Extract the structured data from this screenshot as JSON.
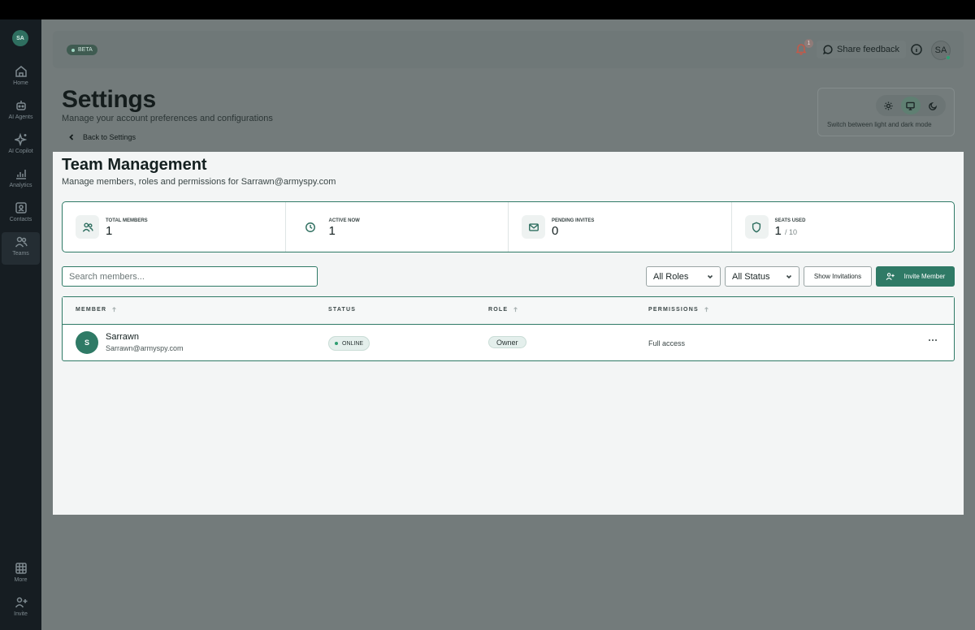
{
  "sidebar": {
    "avatar_initials": "SA",
    "items": [
      {
        "label": "Home",
        "icon": "home-icon"
      },
      {
        "label": "AI Agents",
        "icon": "robot-icon"
      },
      {
        "label": "AI Copilot",
        "icon": "sparkles-icon"
      },
      {
        "label": "Analytics",
        "icon": "bar-chart-icon"
      },
      {
        "label": "Contacts",
        "icon": "contact-card-icon"
      },
      {
        "label": "Teams",
        "icon": "users-icon",
        "active": true
      }
    ],
    "bottom_items": [
      {
        "label": "More",
        "icon": "grid-icon"
      },
      {
        "label": "Invite",
        "icon": "user-plus-icon"
      }
    ]
  },
  "topbar": {
    "beta_label": "BETA",
    "notification_count": "1",
    "feedback_label": "Share feedback",
    "user_initials": "SA"
  },
  "header": {
    "title": "Settings",
    "subtitle": "Manage your account preferences and configurations",
    "back_label": "Back to Settings"
  },
  "theme": {
    "caption": "Switch between light and dark mode",
    "options": [
      "light",
      "system",
      "dark"
    ],
    "selected": "system"
  },
  "team": {
    "title": "Team Management",
    "subtitle": "Manage members, roles and permissions for Sarrawn@armyspy.com"
  },
  "stats": [
    {
      "label": "TOTAL MEMBERS",
      "value": "1",
      "icon": "users-icon"
    },
    {
      "label": "ACTIVE NOW",
      "value": "1",
      "icon": "clock-icon"
    },
    {
      "label": "PENDING INVITES",
      "value": "0",
      "icon": "mail-icon"
    },
    {
      "label": "SEATS USED",
      "value": "1",
      "sub": "/ 10",
      "icon": "shield-icon"
    }
  ],
  "filters": {
    "search_placeholder": "Search members...",
    "role_value": "All Roles",
    "status_value": "All Status",
    "show_invitations_label": "Show Invitations",
    "invite_label": "Invite Member"
  },
  "table": {
    "columns": [
      "MEMBER",
      "STATUS",
      "ROLE",
      "PERMISSIONS"
    ],
    "rows": [
      {
        "initial": "S",
        "name": "Sarrawn",
        "email": "Sarrawn@armyspy.com",
        "status": "ONLINE",
        "role": "Owner",
        "permissions": "Full access"
      }
    ]
  },
  "colors": {
    "accent": "#2f7a66",
    "sidebar_bg": "#161d22",
    "overlay_bg": "#737b7b",
    "online": "#2f9e72",
    "bell": "#c25a4a"
  }
}
